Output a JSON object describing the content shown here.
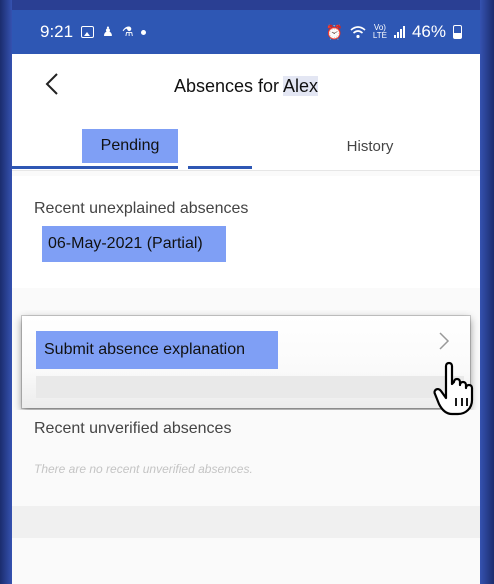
{
  "status_bar": {
    "time": "9:21",
    "battery": "46%"
  },
  "header": {
    "title_prefix": "Absences for",
    "title_name": "Alex"
  },
  "tabs": [
    {
      "label": "Pending",
      "selected": true
    },
    {
      "label": "History",
      "selected": false
    }
  ],
  "unexplained": {
    "label": "Recent unexplained absences",
    "items": [
      "06-May-2021 (Partial)"
    ]
  },
  "submit": {
    "label": "Submit absence explanation"
  },
  "unverified": {
    "label": "Recent unverified absences",
    "empty_text": "There are no recent unverified absences."
  },
  "colors": {
    "status_bar": "#2e57b4",
    "highlight": "#7f9ff5",
    "frame": "#2a3f93"
  },
  "icons": [
    "image-icon",
    "teams-icon",
    "contact-icon",
    "alarm-icon",
    "wifi-icon",
    "lte-icon",
    "signal-icon",
    "battery-icon",
    "back-arrow-icon",
    "chevron-right-icon",
    "hand-cursor-icon"
  ]
}
